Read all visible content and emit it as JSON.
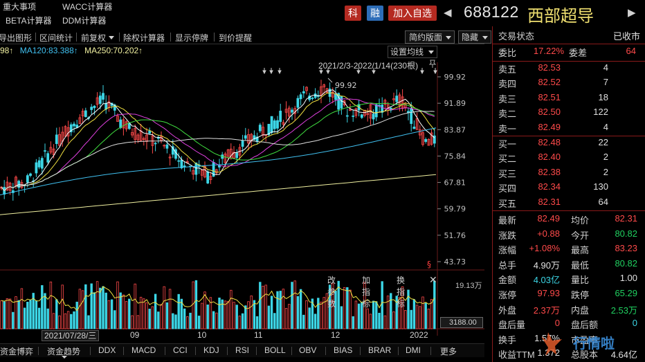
{
  "top": {
    "links": [
      "重大事项",
      "WACC计算器",
      "BETA计算器",
      "DDM计算器"
    ],
    "ke": "科",
    "rong": "融",
    "add": "加入自选",
    "code": "688122",
    "name": "西部超导",
    "prev": "◀",
    "next": "▶"
  },
  "toolbar": {
    "items": [
      "导出图形",
      "区间统计",
      "前复权",
      "除权计算器",
      "显示停牌",
      "到价提醒"
    ],
    "version": "简约版面",
    "hide": "隐藏"
  },
  "ma_legend": {
    "ma_a": "98↑",
    "ma120": "MA120:83.388↑",
    "ma250": "MA250:70.202↑"
  },
  "set_avg": "设置均线",
  "range": "2021/2/3-2022/1/14(230根)",
  "price_ticks": [
    "99.92",
    "91.89",
    "83.87",
    "75.84",
    "67.81",
    "59.79",
    "51.76",
    "43.73"
  ],
  "high_marker": "99.92",
  "indicator_tools": [
    "改参数",
    "加指标",
    "换指标"
  ],
  "close_symbol": "✕",
  "vol_scale": "19.13万",
  "vol_box": "3188.00",
  "date_label": "2021/07/28/三",
  "months": [
    "09",
    "10",
    "11",
    "12",
    "2022"
  ],
  "tabs": [
    "资金博弈",
    "资金趋势",
    "DDX",
    "MACD",
    "CCI",
    "KDJ",
    "RSI",
    "BOLL",
    "OBV",
    "BIAS",
    "BRAR",
    "DMI",
    "更多"
  ],
  "right": {
    "status_label": "交易状态",
    "status_value": "已收市",
    "weibi_label": "委比",
    "weibi_value": "17.22%",
    "weicha_label": "委差",
    "weicha_value": "64",
    "asks": [
      {
        "label": "卖五",
        "price": "82.53",
        "vol": "4"
      },
      {
        "label": "卖四",
        "price": "82.52",
        "vol": "7"
      },
      {
        "label": "卖三",
        "price": "82.51",
        "vol": "18"
      },
      {
        "label": "卖二",
        "price": "82.50",
        "vol": "122"
      },
      {
        "label": "卖一",
        "price": "82.49",
        "vol": "4"
      }
    ],
    "bids": [
      {
        "label": "买一",
        "price": "82.48",
        "vol": "22"
      },
      {
        "label": "买二",
        "price": "82.40",
        "vol": "2"
      },
      {
        "label": "买三",
        "price": "82.38",
        "vol": "2"
      },
      {
        "label": "买四",
        "price": "82.34",
        "vol": "130"
      },
      {
        "label": "买五",
        "price": "82.31",
        "vol": "64"
      }
    ],
    "stats": [
      {
        "l1": "最新",
        "v1": "82.49",
        "c1": "red",
        "l2": "均价",
        "v2": "82.31",
        "c2": "red"
      },
      {
        "l1": "涨跌",
        "v1": "+0.88",
        "c1": "red",
        "l2": "今开",
        "v2": "80.82",
        "c2": "green"
      },
      {
        "l1": "涨幅",
        "v1": "+1.08%",
        "c1": "red",
        "l2": "最高",
        "v2": "83.23",
        "c2": "red"
      },
      {
        "l1": "总手",
        "v1": "4.90万",
        "c1": "white",
        "l2": "最低",
        "v2": "80.82",
        "c2": "green"
      },
      {
        "l1": "金额",
        "v1": "4.03亿",
        "c1": "cyan",
        "l2": "量比",
        "v2": "1.00",
        "c2": "white"
      },
      {
        "l1": "涨停",
        "v1": "97.93",
        "c1": "red",
        "l2": "跌停",
        "v2": "65.29",
        "c2": "green"
      },
      {
        "l1": "外盘",
        "v1": "2.37万",
        "c1": "red",
        "l2": "内盘",
        "v2": "2.53万",
        "c2": "green"
      },
      {
        "l1": "盘后量",
        "v1": "0",
        "c1": "red",
        "l2": "盘后额",
        "v2": "0",
        "c2": "cyan"
      },
      {
        "l1": "换手",
        "v1": "1.57%",
        "c1": "white",
        "l2": "市盈率",
        "v2": "",
        "c2": "white"
      },
      {
        "l1": "收益TTM",
        "v1": "1.372",
        "c1": "white",
        "l2": "总股本",
        "v2": "4.64亿",
        "c2": "white"
      }
    ]
  },
  "watermark": "行情啦",
  "colors": {
    "up": "#ff4a4a",
    "down": "#3cd6e6",
    "ma5": "#ffffff",
    "ma10": "#f0e040",
    "ma20": "#e040e0",
    "ma30": "#40e040",
    "ma60": "#e0e0e0",
    "ma120": "#40c0f0",
    "ma250": "#f0f0a0"
  }
}
